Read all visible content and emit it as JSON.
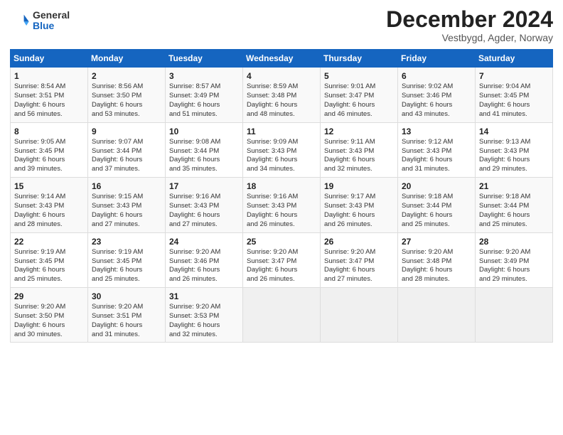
{
  "header": {
    "logo_general": "General",
    "logo_blue": "Blue",
    "month_title": "December 2024",
    "subtitle": "Vestbygd, Agder, Norway"
  },
  "weekdays": [
    "Sunday",
    "Monday",
    "Tuesday",
    "Wednesday",
    "Thursday",
    "Friday",
    "Saturday"
  ],
  "weeks": [
    [
      {
        "day": "1",
        "lines": [
          "Sunrise: 8:54 AM",
          "Sunset: 3:51 PM",
          "Daylight: 6 hours",
          "and 56 minutes."
        ]
      },
      {
        "day": "2",
        "lines": [
          "Sunrise: 8:56 AM",
          "Sunset: 3:50 PM",
          "Daylight: 6 hours",
          "and 53 minutes."
        ]
      },
      {
        "day": "3",
        "lines": [
          "Sunrise: 8:57 AM",
          "Sunset: 3:49 PM",
          "Daylight: 6 hours",
          "and 51 minutes."
        ]
      },
      {
        "day": "4",
        "lines": [
          "Sunrise: 8:59 AM",
          "Sunset: 3:48 PM",
          "Daylight: 6 hours",
          "and 48 minutes."
        ]
      },
      {
        "day": "5",
        "lines": [
          "Sunrise: 9:01 AM",
          "Sunset: 3:47 PM",
          "Daylight: 6 hours",
          "and 46 minutes."
        ]
      },
      {
        "day": "6",
        "lines": [
          "Sunrise: 9:02 AM",
          "Sunset: 3:46 PM",
          "Daylight: 6 hours",
          "and 43 minutes."
        ]
      },
      {
        "day": "7",
        "lines": [
          "Sunrise: 9:04 AM",
          "Sunset: 3:45 PM",
          "Daylight: 6 hours",
          "and 41 minutes."
        ]
      }
    ],
    [
      {
        "day": "8",
        "lines": [
          "Sunrise: 9:05 AM",
          "Sunset: 3:45 PM",
          "Daylight: 6 hours",
          "and 39 minutes."
        ]
      },
      {
        "day": "9",
        "lines": [
          "Sunrise: 9:07 AM",
          "Sunset: 3:44 PM",
          "Daylight: 6 hours",
          "and 37 minutes."
        ]
      },
      {
        "day": "10",
        "lines": [
          "Sunrise: 9:08 AM",
          "Sunset: 3:44 PM",
          "Daylight: 6 hours",
          "and 35 minutes."
        ]
      },
      {
        "day": "11",
        "lines": [
          "Sunrise: 9:09 AM",
          "Sunset: 3:43 PM",
          "Daylight: 6 hours",
          "and 34 minutes."
        ]
      },
      {
        "day": "12",
        "lines": [
          "Sunrise: 9:11 AM",
          "Sunset: 3:43 PM",
          "Daylight: 6 hours",
          "and 32 minutes."
        ]
      },
      {
        "day": "13",
        "lines": [
          "Sunrise: 9:12 AM",
          "Sunset: 3:43 PM",
          "Daylight: 6 hours",
          "and 31 minutes."
        ]
      },
      {
        "day": "14",
        "lines": [
          "Sunrise: 9:13 AM",
          "Sunset: 3:43 PM",
          "Daylight: 6 hours",
          "and 29 minutes."
        ]
      }
    ],
    [
      {
        "day": "15",
        "lines": [
          "Sunrise: 9:14 AM",
          "Sunset: 3:43 PM",
          "Daylight: 6 hours",
          "and 28 minutes."
        ]
      },
      {
        "day": "16",
        "lines": [
          "Sunrise: 9:15 AM",
          "Sunset: 3:43 PM",
          "Daylight: 6 hours",
          "and 27 minutes."
        ]
      },
      {
        "day": "17",
        "lines": [
          "Sunrise: 9:16 AM",
          "Sunset: 3:43 PM",
          "Daylight: 6 hours",
          "and 27 minutes."
        ]
      },
      {
        "day": "18",
        "lines": [
          "Sunrise: 9:16 AM",
          "Sunset: 3:43 PM",
          "Daylight: 6 hours",
          "and 26 minutes."
        ]
      },
      {
        "day": "19",
        "lines": [
          "Sunrise: 9:17 AM",
          "Sunset: 3:43 PM",
          "Daylight: 6 hours",
          "and 26 minutes."
        ]
      },
      {
        "day": "20",
        "lines": [
          "Sunrise: 9:18 AM",
          "Sunset: 3:44 PM",
          "Daylight: 6 hours",
          "and 25 minutes."
        ]
      },
      {
        "day": "21",
        "lines": [
          "Sunrise: 9:18 AM",
          "Sunset: 3:44 PM",
          "Daylight: 6 hours",
          "and 25 minutes."
        ]
      }
    ],
    [
      {
        "day": "22",
        "lines": [
          "Sunrise: 9:19 AM",
          "Sunset: 3:45 PM",
          "Daylight: 6 hours",
          "and 25 minutes."
        ]
      },
      {
        "day": "23",
        "lines": [
          "Sunrise: 9:19 AM",
          "Sunset: 3:45 PM",
          "Daylight: 6 hours",
          "and 25 minutes."
        ]
      },
      {
        "day": "24",
        "lines": [
          "Sunrise: 9:20 AM",
          "Sunset: 3:46 PM",
          "Daylight: 6 hours",
          "and 26 minutes."
        ]
      },
      {
        "day": "25",
        "lines": [
          "Sunrise: 9:20 AM",
          "Sunset: 3:47 PM",
          "Daylight: 6 hours",
          "and 26 minutes."
        ]
      },
      {
        "day": "26",
        "lines": [
          "Sunrise: 9:20 AM",
          "Sunset: 3:47 PM",
          "Daylight: 6 hours",
          "and 27 minutes."
        ]
      },
      {
        "day": "27",
        "lines": [
          "Sunrise: 9:20 AM",
          "Sunset: 3:48 PM",
          "Daylight: 6 hours",
          "and 28 minutes."
        ]
      },
      {
        "day": "28",
        "lines": [
          "Sunrise: 9:20 AM",
          "Sunset: 3:49 PM",
          "Daylight: 6 hours",
          "and 29 minutes."
        ]
      }
    ],
    [
      {
        "day": "29",
        "lines": [
          "Sunrise: 9:20 AM",
          "Sunset: 3:50 PM",
          "Daylight: 6 hours",
          "and 30 minutes."
        ]
      },
      {
        "day": "30",
        "lines": [
          "Sunrise: 9:20 AM",
          "Sunset: 3:51 PM",
          "Daylight: 6 hours",
          "and 31 minutes."
        ]
      },
      {
        "day": "31",
        "lines": [
          "Sunrise: 9:20 AM",
          "Sunset: 3:53 PM",
          "Daylight: 6 hours",
          "and 32 minutes."
        ]
      },
      null,
      null,
      null,
      null
    ]
  ]
}
